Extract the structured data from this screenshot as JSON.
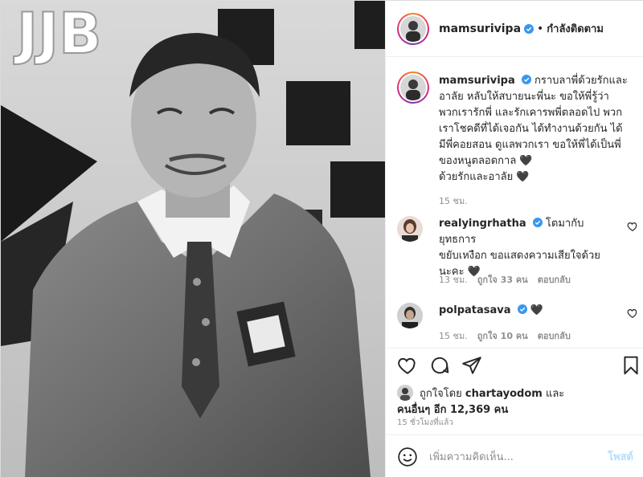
{
  "header": {
    "username": "mamsurivipa",
    "follow_status": "กำลังติดตาม",
    "separator": "•"
  },
  "caption": {
    "username": "mamsurivipa",
    "text_lines": [
      "กราบลาพี่ด้วยรักและ",
      "อาลัย หลับให้สบายนะพี่นะ ขอให้พี่รู้ว่า",
      "พวกเรารักพี่ และรักเคารพพี่ตลอดไป พวก",
      "เราโชคดีที่ได้เจอกัน ได้ทำงานด้วยกัน ได้",
      "มีพี่คอยสอน ดูแลพวกเรา ขอให้พี่ได้เป็นพี่",
      "ของหนูตลอดกาล 🖤",
      "ด้วยรักและอาลัย 🖤"
    ],
    "time": "15 ชม."
  },
  "comments": [
    {
      "username": "realyingrhatha",
      "text_lines": [
        "โตมากับ ยุทธการ",
        "ขยับเหงือก ขอแสดงความเสียใจด้วย",
        "นะคะ 🖤"
      ],
      "time": "13 ชม.",
      "likes": "ถูกใจ 33 คน",
      "reply": "ตอบกลับ"
    },
    {
      "username": "polpatasava",
      "text_lines": [
        "🖤"
      ],
      "time": "15 ชม.",
      "likes": "ถูกใจ 10 คน",
      "reply": "ตอบกลับ"
    }
  ],
  "likes": {
    "prefix": "ถูกใจโดย",
    "first_user": "chartayodom",
    "and": "และ",
    "others": "คนอื่นๆ อีก 12,369 คน"
  },
  "post_time": "15 ชั่วโมงที่แล้ว",
  "add_comment": {
    "placeholder": "เพิ่มความคิดเห็น...",
    "post_label": "โพสต์"
  },
  "icons": {
    "verified": "verified-badge-icon",
    "heart": "heart-icon",
    "comment": "comment-icon",
    "share": "share-icon",
    "bookmark": "bookmark-icon",
    "emoji": "emoji-icon"
  },
  "colors": {
    "verified_blue": "#3897f0",
    "text": "#262626",
    "muted": "#8e8e8e",
    "post_disabled": "#b2dffc"
  }
}
